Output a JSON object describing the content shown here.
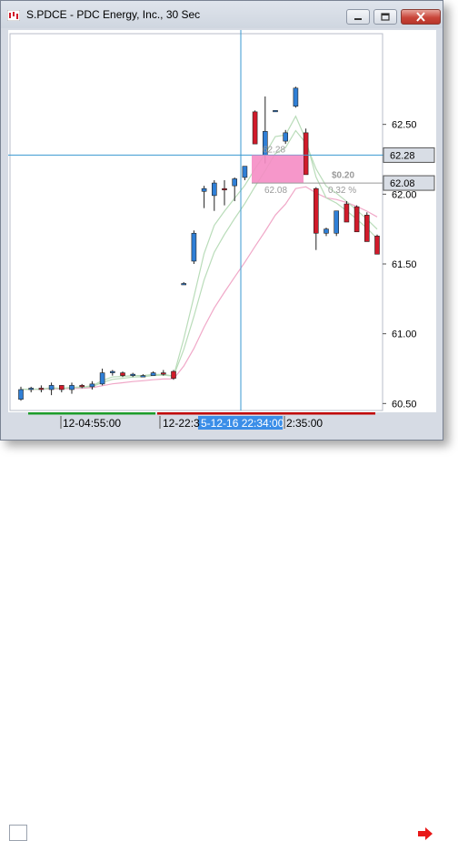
{
  "window": {
    "title": "S.PDCE - PDC Energy, Inc., 30 Sec",
    "icon": "chart-app-icon",
    "buttons": [
      "minimize-icon",
      "maximize-icon",
      "close-icon"
    ]
  },
  "colors": {
    "up_candle": "#2f7fd6",
    "down_candle": "#d11a2a",
    "fast_ma": "#b9dcb9",
    "slow_ma": "#f0a8c8",
    "crosshair": "#3a9ad0",
    "measure_box": "#f58cc4",
    "price_flag_bg": "#d8dde5",
    "axis_line": "#c00000"
  },
  "crosshair": {
    "price_label": "62.28",
    "measure_end_label": "62.08",
    "measure_top_text": "62.28",
    "measure_bottom_text": "62.08",
    "change_text": "$0.20",
    "pct_text": "0.32 %"
  },
  "time_axis": {
    "label_1": "12-04:55:00",
    "label_2": "12-22:3",
    "label_3_prefix": "",
    "crosshair_time": "5-12-16 22:34:00",
    "label_4": "2:35:00"
  },
  "chart_data": {
    "type": "candlestick",
    "title": "S.PDCE - PDC Energy, Inc., 30 Sec",
    "ylim": [
      60.45,
      63.15
    ],
    "y_ticks": [
      "62.50",
      "62.00",
      "61.50",
      "61.00",
      "60.50"
    ],
    "y_tick_values": [
      62.5,
      62.0,
      61.5,
      61.0,
      60.5
    ],
    "series": [
      {
        "name": "",
        "candles": [
          {
            "o": 60.53,
            "h": 60.62,
            "l": 60.52,
            "c": 60.6
          },
          {
            "o": 60.6,
            "h": 60.62,
            "l": 60.58,
            "c": 60.61
          },
          {
            "o": 60.61,
            "h": 60.63,
            "l": 60.58,
            "c": 60.6
          },
          {
            "o": 60.6,
            "h": 60.65,
            "l": 60.56,
            "c": 60.63
          },
          {
            "o": 60.63,
            "h": 60.63,
            "l": 60.58,
            "c": 60.6
          },
          {
            "o": 60.6,
            "h": 60.65,
            "l": 60.57,
            "c": 60.63
          },
          {
            "o": 60.63,
            "h": 60.64,
            "l": 60.61,
            "c": 60.62
          },
          {
            "o": 60.62,
            "h": 60.66,
            "l": 60.6,
            "c": 60.64
          },
          {
            "o": 60.64,
            "h": 60.75,
            "l": 60.63,
            "c": 60.72
          },
          {
            "o": 60.72,
            "h": 60.74,
            "l": 60.7,
            "c": 60.73
          },
          {
            "o": 60.72,
            "h": 60.73,
            "l": 60.69,
            "c": 60.7
          },
          {
            "o": 60.7,
            "h": 60.72,
            "l": 60.69,
            "c": 60.71
          },
          {
            "o": 60.7,
            "h": 60.71,
            "l": 60.69,
            "c": 60.7
          },
          {
            "o": 60.7,
            "h": 60.73,
            "l": 60.7,
            "c": 60.72
          },
          {
            "o": 60.72,
            "h": 60.74,
            "l": 60.7,
            "c": 60.71
          },
          {
            "o": 60.73,
            "h": 60.74,
            "l": 60.67,
            "c": 60.68
          },
          {
            "o": 61.36,
            "h": 61.37,
            "l": 61.35,
            "c": 61.36
          },
          {
            "o": 61.52,
            "h": 61.74,
            "l": 61.5,
            "c": 61.72
          },
          {
            "o": 62.02,
            "h": 62.06,
            "l": 61.9,
            "c": 62.04
          },
          {
            "o": 61.99,
            "h": 62.1,
            "l": 61.88,
            "c": 62.08
          },
          {
            "o": 62.04,
            "h": 62.1,
            "l": 61.92,
            "c": 62.03
          },
          {
            "o": 62.06,
            "h": 62.12,
            "l": 61.95,
            "c": 62.11
          },
          {
            "o": 62.12,
            "h": 62.2,
            "l": 62.1,
            "c": 62.2
          },
          {
            "o": 62.59,
            "h": 62.6,
            "l": 62.36,
            "c": 62.36
          },
          {
            "o": 62.28,
            "h": 62.7,
            "l": 62.22,
            "c": 62.45
          },
          {
            "o": 62.6,
            "h": 62.6,
            "l": 62.6,
            "c": 62.6
          },
          {
            "o": 62.38,
            "h": 62.46,
            "l": 62.36,
            "c": 62.44
          },
          {
            "o": 62.63,
            "h": 62.77,
            "l": 62.62,
            "c": 62.76
          },
          {
            "o": 62.44,
            "h": 62.47,
            "l": 62.15,
            "c": 62.14
          },
          {
            "o": 62.04,
            "h": 62.05,
            "l": 61.6,
            "c": 61.72
          },
          {
            "o": 61.72,
            "h": 61.76,
            "l": 61.7,
            "c": 61.75
          },
          {
            "o": 61.72,
            "h": 61.88,
            "l": 61.7,
            "c": 61.88
          },
          {
            "o": 61.93,
            "h": 61.95,
            "l": 61.86,
            "c": 61.8
          },
          {
            "o": 61.91,
            "h": 61.92,
            "l": 61.75,
            "c": 61.73
          },
          {
            "o": 61.85,
            "h": 61.87,
            "l": 61.68,
            "c": 61.66
          },
          {
            "o": 61.7,
            "h": 61.71,
            "l": 61.58,
            "c": 61.57
          }
        ]
      }
    ]
  }
}
